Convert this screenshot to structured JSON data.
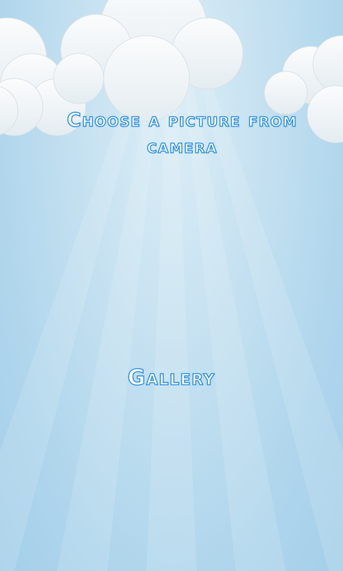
{
  "screen": {
    "title_label": "Choose a picture from camera",
    "gallery_label": "Gallery"
  },
  "colors": {
    "sky_light": "#ddeef7",
    "sky_dark": "#a4cfe9",
    "text_outline": "#2b8fe0",
    "cloud": "#f7f8f9"
  }
}
